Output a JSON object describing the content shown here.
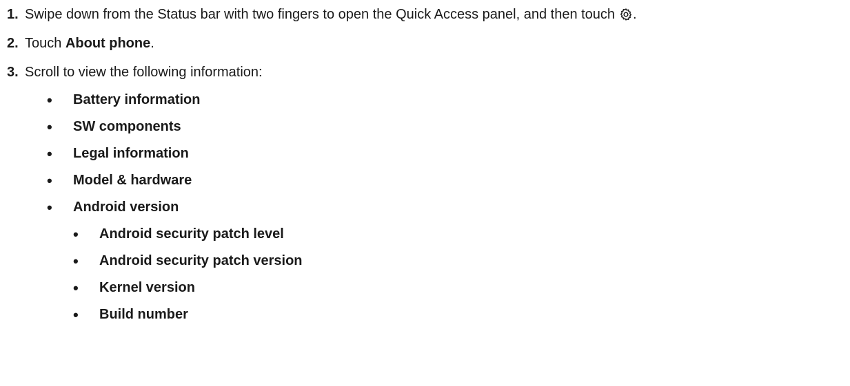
{
  "steps": [
    {
      "number": "1.",
      "text": "Swipe down from the Status bar with two fingers to open the Quick Access panel, and then touch",
      "icon": "settings-gear-icon",
      "end": "."
    },
    {
      "number": "2.",
      "prefix": "Touch ",
      "bold": "About phone",
      "end": "."
    },
    {
      "number": "3.",
      "text": "Scroll to view the following information:"
    }
  ],
  "bullets": [
    "Battery information",
    "SW components",
    "Legal information",
    "Model & hardware",
    "Android version"
  ],
  "sub_bullets": [
    "Android security patch level",
    "Android security patch version",
    "Kernel version",
    "Build number"
  ],
  "bullet_glyph": "•"
}
